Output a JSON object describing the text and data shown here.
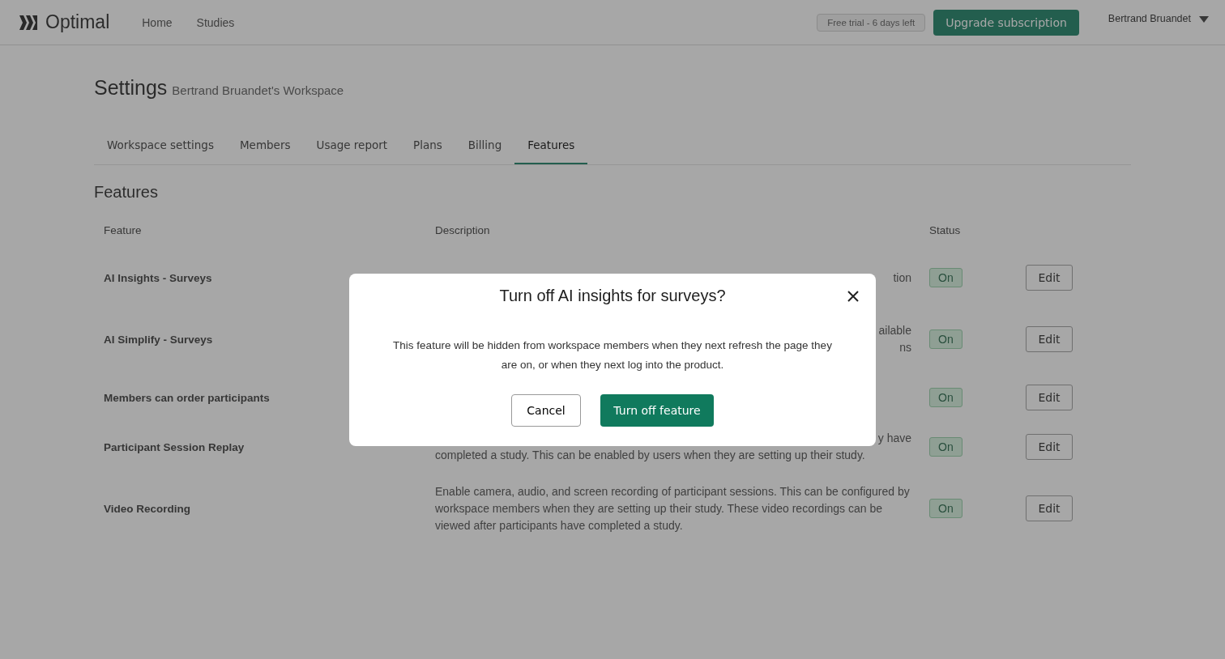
{
  "nav": {
    "brand": "Optimal",
    "links": [
      {
        "label": "Home",
        "selected": false
      },
      {
        "label": "Studies",
        "selected": false
      }
    ],
    "trial_badge": "Free trial - 6 days left",
    "upgrade_button": "Upgrade subscription",
    "user": "Bertrand Bruandet"
  },
  "header": {
    "title": "Settings",
    "subtitle": "Bertrand Bruandet's Workspace"
  },
  "tabs": [
    {
      "label": "Workspace settings",
      "selected": false
    },
    {
      "label": "Members",
      "selected": false
    },
    {
      "label": "Usage report",
      "selected": false
    },
    {
      "label": "Plans",
      "selected": false
    },
    {
      "label": "Billing",
      "selected": false
    },
    {
      "label": "Features",
      "selected": true
    }
  ],
  "section_title": "Features",
  "table": {
    "columns": [
      "Feature",
      "Description",
      "Status"
    ],
    "rows": [
      {
        "feature": "AI Insights - Surveys",
        "description": [
          {
            "kind": "fragment",
            "text": "tion"
          }
        ],
        "status": "On",
        "on": true,
        "action": "Edit"
      },
      {
        "feature": "AI Simplify - Surveys",
        "description": [
          {
            "kind": "fragment",
            "text": "ailable"
          },
          {
            "kind": "fragment",
            "text": "ns"
          }
        ],
        "status": "On",
        "on": true,
        "action": "Edit"
      },
      {
        "feature": "Members can order participants",
        "description": [],
        "status": "On",
        "on": true,
        "action": "Edit"
      },
      {
        "feature": "Participant Session Replay",
        "description": [
          {
            "kind": "fragment",
            "text": "y have"
          },
          {
            "kind": "full",
            "text": "completed a study. This can be enabled by users when they are setting up their study."
          }
        ],
        "status": "On",
        "on": true,
        "action": "Edit"
      },
      {
        "feature": "Video Recording",
        "description": [
          {
            "kind": "full",
            "text": "Enable camera, audio, and screen recording of participant sessions. This can be configured by workspace members when they are setting up their study. These video recordings can be viewed after participants have completed a study."
          }
        ],
        "status": "On",
        "on": true,
        "action": "Edit"
      }
    ]
  },
  "dialog": {
    "title": "Turn off AI insights for surveys?",
    "body": "This feature will be hidden from workspace members when they next refresh the page they are on, or when they next log into the product.",
    "cancel": "Cancel",
    "confirm": "Turn off feature"
  }
}
